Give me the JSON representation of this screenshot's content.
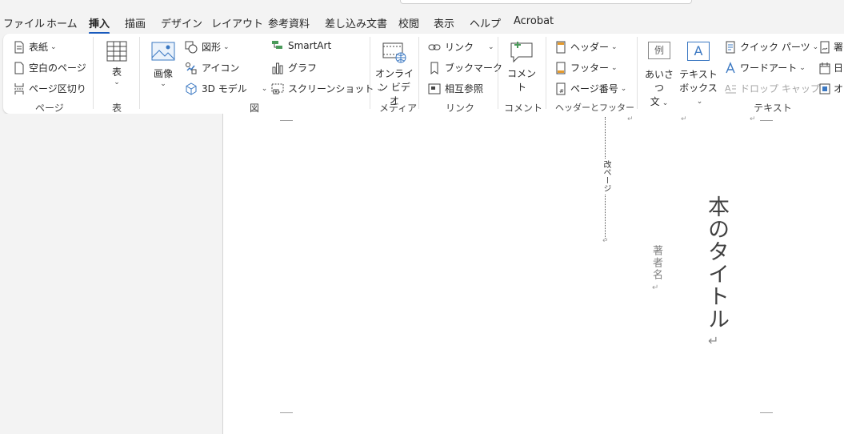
{
  "tabs": [
    "ファイル",
    "ホーム",
    "挿入",
    "描画",
    "デザイン",
    "レイアウト",
    "参考資料",
    "差し込み文書",
    "校閲",
    "表示",
    "ヘルプ",
    "Acrobat"
  ],
  "ribbon": {
    "page_group": {
      "label": "ページ",
      "cover": "表紙",
      "blank": "空白のページ",
      "break": "ページ区切り"
    },
    "table_group": {
      "label": "表",
      "table": "表"
    },
    "illust_group": {
      "label": "図",
      "image": "画像",
      "shapes": "図形",
      "icons": "アイコン",
      "model3d": "3D モデル",
      "smartart": "SmartArt",
      "chart": "グラフ",
      "screenshot": "スクリーンショット"
    },
    "media_group": {
      "label": "メディア",
      "online_video_1": "オンライ",
      "online_video_2": "ン ビデオ"
    },
    "link_group": {
      "label": "リンク",
      "link": "リンク",
      "bookmark": "ブックマーク",
      "crossref": "相互参照"
    },
    "comment_group": {
      "label": "コメント",
      "comment": "コメント"
    },
    "hf_group": {
      "label": "ヘッダーとフッター",
      "header": "ヘッダー",
      "footer": "フッター",
      "pagenum": "ページ番号"
    },
    "text_group": {
      "label": "テキスト",
      "greeting_1": "あいさつ",
      "greeting_2": "文",
      "textbox_1": "テキスト",
      "textbox_2": "ボックス",
      "quickparts": "クイック パーツ",
      "wordart": "ワードアート",
      "dropcap": "ドロップ キャップ",
      "sig": "署",
      "date": "日",
      "obj": "オ",
      "icon_greeting": "例",
      "icon_textbox": "A"
    }
  },
  "document": {
    "page_break": "改ページ",
    "author": "著者名",
    "title": "本のタイトル",
    "para_mark": "↵"
  }
}
